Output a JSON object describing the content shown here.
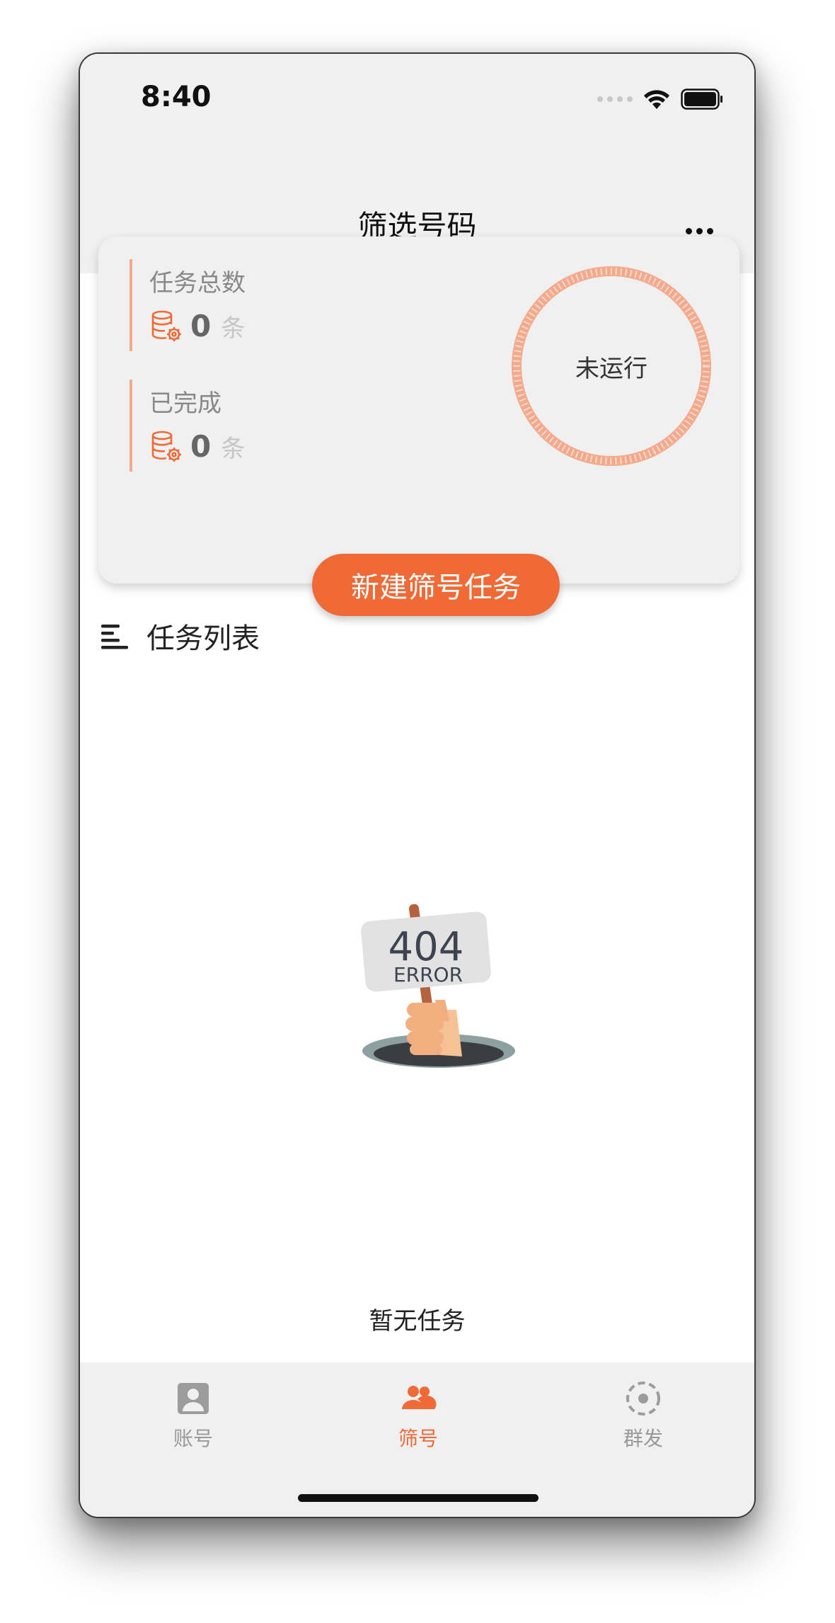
{
  "status_bar": {
    "time": "8:40"
  },
  "nav": {
    "title": "筛选号码",
    "more_icon": "more-icon"
  },
  "summary": {
    "total": {
      "label": "任务总数",
      "value": "0",
      "unit": "条"
    },
    "completed": {
      "label": "已完成",
      "value": "0",
      "unit": "条"
    },
    "status": "未运行",
    "new_button": "新建筛号任务"
  },
  "task_list": {
    "title": "任务列表",
    "empty_image": {
      "big": "404",
      "small": "ERROR"
    },
    "empty_text": "暂无任务"
  },
  "tabs": [
    {
      "label": "账号",
      "icon": "account-icon",
      "active": false
    },
    {
      "label": "筛号",
      "icon": "users-icon",
      "active": true
    },
    {
      "label": "群发",
      "icon": "broadcast-icon",
      "active": false
    }
  ],
  "colors": {
    "accent": "#f06a38",
    "inactive": "#999999",
    "ring": "#f2a98c"
  }
}
